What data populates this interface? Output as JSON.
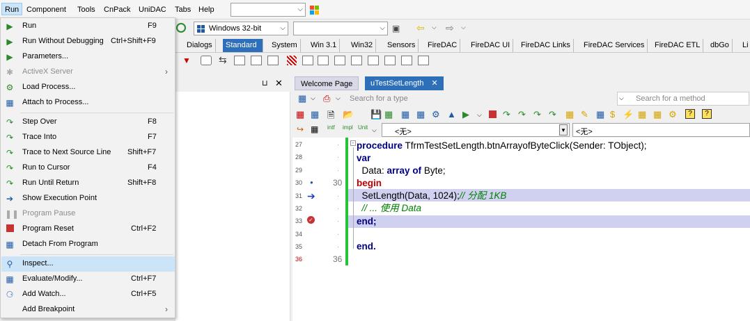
{
  "menubar": {
    "items": [
      "Run",
      "Component",
      "Tools",
      "CnPack",
      "UniDAC",
      "Tabs",
      "Help"
    ]
  },
  "toolbar": {
    "platform": "Windows 32-bit"
  },
  "palette_tabs": [
    "Dialogs",
    "Standard",
    "System",
    "Win 3.1",
    "Win32",
    "Sensors",
    "FireDAC",
    "FireDAC UI",
    "FireDAC Links",
    "FireDAC Services",
    "FireDAC ETL",
    "dbGo",
    "Li"
  ],
  "palette_selected": "Standard",
  "editor": {
    "tabs": [
      "Welcome Page",
      "uTestSetLength"
    ],
    "search_type_placeholder": "Search for a type",
    "search_method_placeholder": "Search for a method",
    "combo1": "<无>",
    "combo2": "<无>",
    "lines": [
      {
        "num": "27",
        "code": "procedure TfrmTestSetLength.btnArrayofByteClick(Sender: TObject);"
      },
      {
        "num": "28",
        "code": "var"
      },
      {
        "num": "29",
        "code": "  Data: array of Byte;"
      },
      {
        "num": "30",
        "code": "begin"
      },
      {
        "num": "31",
        "code": "  SetLength(Data, 1024);// 分配 1KB"
      },
      {
        "num": "32",
        "code": "  // ... 使用 Data"
      },
      {
        "num": "33",
        "code": "end;"
      },
      {
        "num": "34",
        "code": ""
      },
      {
        "num": "35",
        "code": "end."
      },
      {
        "num": "36",
        "code": ""
      }
    ],
    "gutter_mark_30": "30",
    "gutter_mark_36": "36"
  },
  "run_menu": [
    {
      "label": "Run",
      "shortcut": "F9",
      "icon": "run-icon"
    },
    {
      "label": "Run Without Debugging",
      "shortcut": "Ctrl+Shift+F9",
      "icon": "run-without-debug-icon"
    },
    {
      "label": "Parameters...",
      "shortcut": "",
      "icon": "parameters-icon"
    },
    {
      "label": "ActiveX Server",
      "shortcut": "",
      "icon": "activex-icon",
      "disabled": true,
      "submenu": true
    },
    {
      "label": "Load Process...",
      "shortcut": "",
      "icon": "load-process-icon"
    },
    {
      "label": "Attach to Process...",
      "shortcut": "",
      "icon": "attach-icon"
    },
    {
      "label": "Step Over",
      "shortcut": "F8",
      "icon": "step-over-icon"
    },
    {
      "label": "Trace Into",
      "shortcut": "F7",
      "icon": "trace-into-icon"
    },
    {
      "label": "Trace to Next Source Line",
      "shortcut": "Shift+F7",
      "icon": "trace-next-icon"
    },
    {
      "label": "Run to Cursor",
      "shortcut": "F4",
      "icon": "run-to-cursor-icon"
    },
    {
      "label": "Run Until Return",
      "shortcut": "Shift+F8",
      "icon": "run-until-return-icon"
    },
    {
      "label": "Show Execution Point",
      "shortcut": "",
      "icon": "show-exec-point-icon"
    },
    {
      "label": "Program Pause",
      "shortcut": "",
      "icon": "pause-icon",
      "disabled": true
    },
    {
      "label": "Program Reset",
      "shortcut": "Ctrl+F2",
      "icon": "reset-icon"
    },
    {
      "label": "Detach From Program",
      "shortcut": "",
      "icon": "detach-icon"
    },
    {
      "label": "Inspect...",
      "shortcut": "",
      "icon": "inspect-icon",
      "hot": true
    },
    {
      "label": "Evaluate/Modify...",
      "shortcut": "Ctrl+F7",
      "icon": "evaluate-icon"
    },
    {
      "label": "Add Watch...",
      "shortcut": "Ctrl+F5",
      "icon": "add-watch-icon"
    },
    {
      "label": "Add Breakpoint",
      "shortcut": "",
      "icon": "add-breakpoint-icon",
      "submenu": true
    }
  ]
}
